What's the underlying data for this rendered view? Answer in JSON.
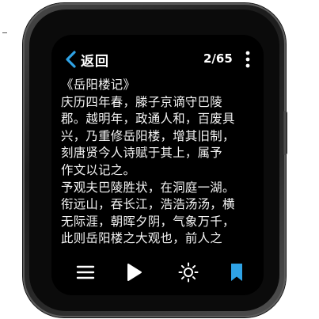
{
  "header": {
    "back_label": "返回",
    "page_indicator": "2/65"
  },
  "content": {
    "title": "《岳阳楼记》",
    "lines": [
      "庆历四年春，滕子京谪守巴陵",
      "郡。越明年，政通人和，百废具",
      "兴，乃重修岳阳楼，增其旧制，",
      "刻唐贤今人诗赋于其上，属予",
      "作文以记之。",
      "予观夫巴陵胜状，在洞庭一湖。",
      "衔远山，吞长江，浩浩汤汤，横",
      "无际涯，朝晖夕阴，气象万千，",
      "此则岳阳楼之大观也，前人之"
    ]
  },
  "toolbar": {
    "icons": [
      "menu-icon",
      "play-icon",
      "brightness-icon",
      "bookmark-icon"
    ]
  },
  "colors": {
    "screen_bg": "#000000",
    "text": "#f4f4f4",
    "accent": "#2fa3e6"
  }
}
